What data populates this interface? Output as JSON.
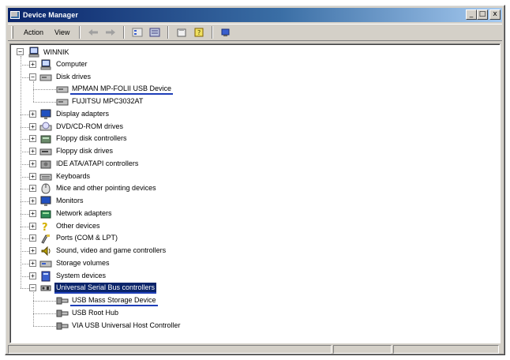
{
  "window": {
    "title": "Device Manager",
    "buttons": {
      "minimize": "_",
      "maximize": "□",
      "close": "x"
    }
  },
  "toolbar": {
    "menus": [
      {
        "label": "Action"
      },
      {
        "label": "View"
      }
    ],
    "tools": [
      "back-arrow-icon",
      "forward-arrow-icon",
      "view-icon",
      "list-icon",
      "properties-icon",
      "help-icon",
      "scan-icon"
    ]
  },
  "tree": {
    "root": {
      "label": "WINNIK",
      "icon": "computer-icon"
    },
    "categories": [
      {
        "label": "Computer",
        "expanded": false,
        "icon": "computer-icon",
        "color": "#3a5fcd"
      },
      {
        "label": "Disk drives",
        "expanded": true,
        "icon": "disk-icon",
        "color": "#808080",
        "children": [
          {
            "label": "MPMAN MP-FOLII USB Device",
            "underlined": true
          },
          {
            "label": "FUJITSU MPC3032AT"
          }
        ]
      },
      {
        "label": "Display adapters",
        "expanded": false,
        "icon": "monitor-icon",
        "color": "#3a5fcd"
      },
      {
        "label": "DVD/CD-ROM drives",
        "expanded": false,
        "icon": "cdrom-icon",
        "color": "#b0b0b0"
      },
      {
        "label": "Floppy disk controllers",
        "expanded": false,
        "icon": "floppy-controller-icon",
        "color": "#6a8a6a"
      },
      {
        "label": "Floppy disk drives",
        "expanded": false,
        "icon": "floppy-icon",
        "color": "#808080"
      },
      {
        "label": "IDE ATA/ATAPI controllers",
        "expanded": false,
        "icon": "ide-icon",
        "color": "#909090"
      },
      {
        "label": "Keyboards",
        "expanded": false,
        "icon": "keyboard-icon",
        "color": "#707070"
      },
      {
        "label": "Mice and other pointing devices",
        "expanded": false,
        "icon": "mouse-icon",
        "color": "#a0a0a0"
      },
      {
        "label": "Monitors",
        "expanded": false,
        "icon": "monitor-icon",
        "color": "#3a5fcd"
      },
      {
        "label": "Network adapters",
        "expanded": false,
        "icon": "network-icon",
        "color": "#2e8b57"
      },
      {
        "label": "Other devices",
        "expanded": false,
        "icon": "question-icon",
        "color": "#d4b000"
      },
      {
        "label": "Ports (COM & LPT)",
        "expanded": false,
        "icon": "port-icon",
        "color": "#808080"
      },
      {
        "label": "Sound, video and game controllers",
        "expanded": false,
        "icon": "sound-icon",
        "color": "#b8a000"
      },
      {
        "label": "Storage volumes",
        "expanded": false,
        "icon": "storage-icon",
        "color": "#808080"
      },
      {
        "label": "System devices",
        "expanded": false,
        "icon": "system-icon",
        "color": "#3a5fcd"
      },
      {
        "label": "Universal Serial Bus controllers",
        "expanded": true,
        "selected": true,
        "underlined": true,
        "icon": "usb-icon",
        "color": "#606060",
        "children": [
          {
            "label": "USB Mass Storage Device",
            "underlined": true
          },
          {
            "label": "USB Root Hub"
          },
          {
            "label": "VIA USB Universal Host Controller"
          }
        ]
      }
    ]
  },
  "statusbar": {
    "panes": [
      "",
      "",
      ""
    ]
  }
}
